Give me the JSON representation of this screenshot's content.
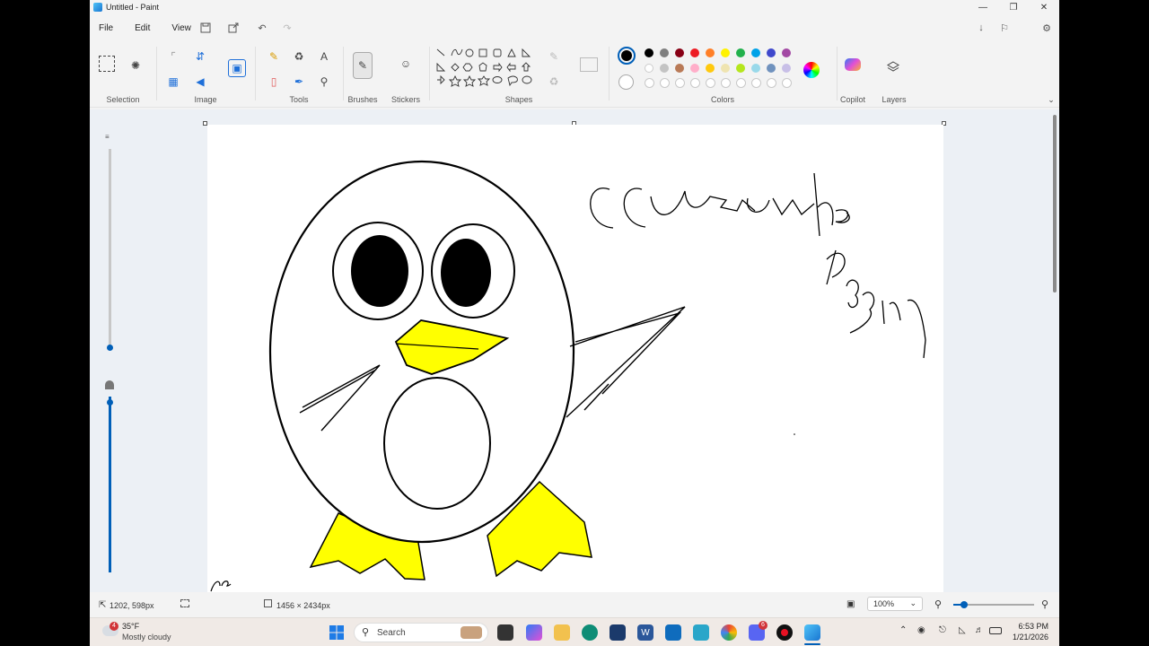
{
  "window": {
    "title": "Untitled - Paint"
  },
  "menu": {
    "file": "File",
    "edit": "Edit",
    "view": "View"
  },
  "ribbon": {
    "groups": {
      "selection": "Selection",
      "image": "Image",
      "tools": "Tools",
      "brushes": "Brushes",
      "stickers": "Stickers",
      "shapes": "Shapes",
      "colors": "Colors",
      "copilot": "Copilot",
      "layers": "Layers"
    },
    "colors_row1": [
      "#000000",
      "#7f7f7f",
      "#880015",
      "#ed1c24",
      "#ff7f27",
      "#fff200",
      "#22b14c",
      "#00a2e8",
      "#3f48cc",
      "#a349a4"
    ],
    "colors_row2": [
      "#ffffff",
      "#c3c3c3",
      "#b97a57",
      "#ffaec9",
      "#ffc90e",
      "#efe4b0",
      "#b5e61d",
      "#99d9ea",
      "#7092be",
      "#c8bfe7"
    ],
    "active_color": "#000000"
  },
  "canvas": {
    "handwriting_label": "handwritten text on canvas"
  },
  "status": {
    "cursor_pos": "1202, 598px",
    "canvas_size": "1456 × 2434px",
    "zoom": "100%"
  },
  "taskbar": {
    "weather_temp": "35°F",
    "weather_desc": "Mostly cloudy",
    "weather_badge": "4",
    "search": "Search",
    "time": "6:53 PM",
    "date": "1/21/2026",
    "discord_badge": "6"
  },
  "accent": "#005fb8",
  "beak_color": "#ffff00"
}
